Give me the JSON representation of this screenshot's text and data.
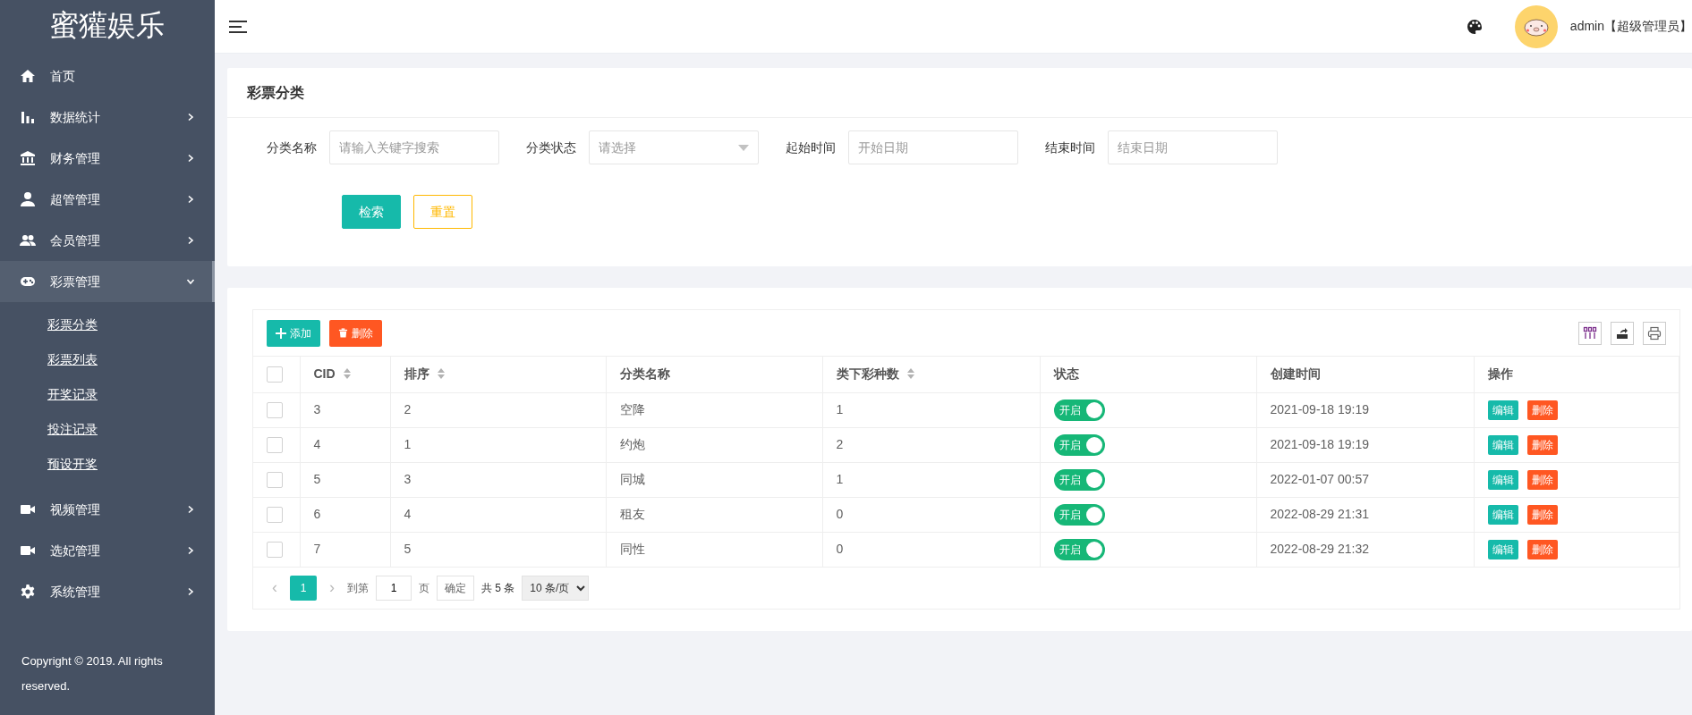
{
  "sidebar": {
    "logo": "蜜獾娱乐",
    "items": [
      {
        "label": "首页",
        "selected": false
      },
      {
        "label": "数据统计",
        "expanded": false,
        "selected": false
      },
      {
        "label": "财务管理",
        "expanded": false,
        "selected": false
      },
      {
        "label": "超管管理",
        "expanded": false,
        "selected": false
      },
      {
        "label": "会员管理",
        "expanded": false,
        "selected": false
      },
      {
        "label": "彩票管理",
        "expanded": true,
        "selected": true,
        "children": [
          {
            "label": "彩票分类"
          },
          {
            "label": "彩票列表"
          },
          {
            "label": "开奖记录"
          },
          {
            "label": "投注记录"
          },
          {
            "label": "预设开奖"
          }
        ]
      },
      {
        "label": "视频管理",
        "expanded": false,
        "selected": false
      },
      {
        "label": "选妃管理",
        "expanded": false,
        "selected": false
      },
      {
        "label": "系统管理",
        "expanded": false,
        "selected": false
      }
    ],
    "copyright": "Copyright © 2019. All rights reserved."
  },
  "header": {
    "user": "admin【超级管理员】"
  },
  "search_card": {
    "title": "彩票分类",
    "fields": [
      {
        "kind": "text",
        "label": "分类名称",
        "placeholder": "请输入关键字搜索"
      },
      {
        "kind": "select",
        "label": "分类状态",
        "placeholder": "请选择"
      },
      {
        "kind": "text",
        "label": "起始时间",
        "placeholder": "开始日期"
      },
      {
        "kind": "text",
        "label": "结束时间",
        "placeholder": "结束日期"
      }
    ],
    "buttons": [
      {
        "kind": "primary",
        "label": "检索"
      },
      {
        "kind": "outline",
        "label": "重置"
      }
    ]
  },
  "table": {
    "toolbar": [
      {
        "kind": "add",
        "label": "添加"
      },
      {
        "kind": "delete",
        "label": "删除"
      }
    ],
    "select_all": {
      "checked": false
    },
    "columns": [
      {
        "label": "CID",
        "sortable": true
      },
      {
        "label": "排序",
        "sortable": true
      },
      {
        "label": "分类名称",
        "sortable": false
      },
      {
        "label": "类下彩种数",
        "sortable": true
      },
      {
        "label": "状态",
        "sortable": false
      },
      {
        "label": "创建时间",
        "sortable": false
      },
      {
        "label": "操作",
        "sortable": false
      }
    ],
    "rows": [
      {
        "checked": false,
        "cid": "3",
        "order": "2",
        "name": "空降",
        "count": "1",
        "status": {
          "label": "开启",
          "on": true
        },
        "created": "2021-09-18 19:19",
        "actions": [
          "编辑",
          "删除"
        ]
      },
      {
        "checked": false,
        "cid": "4",
        "order": "1",
        "name": "约炮",
        "count": "2",
        "status": {
          "label": "开启",
          "on": true
        },
        "created": "2021-09-18 19:19",
        "actions": [
          "编辑",
          "删除"
        ]
      },
      {
        "checked": false,
        "cid": "5",
        "order": "3",
        "name": "同城",
        "count": "1",
        "status": {
          "label": "开启",
          "on": true
        },
        "created": "2022-01-07 00:57",
        "actions": [
          "编辑",
          "删除"
        ]
      },
      {
        "checked": false,
        "cid": "6",
        "order": "4",
        "name": "租友",
        "count": "0",
        "status": {
          "label": "开启",
          "on": true
        },
        "created": "2022-08-29 21:31",
        "actions": [
          "编辑",
          "删除"
        ]
      },
      {
        "checked": false,
        "cid": "7",
        "order": "5",
        "name": "同性",
        "count": "0",
        "status": {
          "label": "开启",
          "on": true
        },
        "created": "2022-08-29 21:32",
        "actions": [
          "编辑",
          "删除"
        ]
      }
    ],
    "pagination": {
      "prev": "‹",
      "current": "1",
      "next": "›",
      "goto_label": "到第",
      "page_value": "1",
      "page_unit": "页",
      "confirm": "确定",
      "total": "共 5 条",
      "page_size": "10 条/页"
    }
  }
}
